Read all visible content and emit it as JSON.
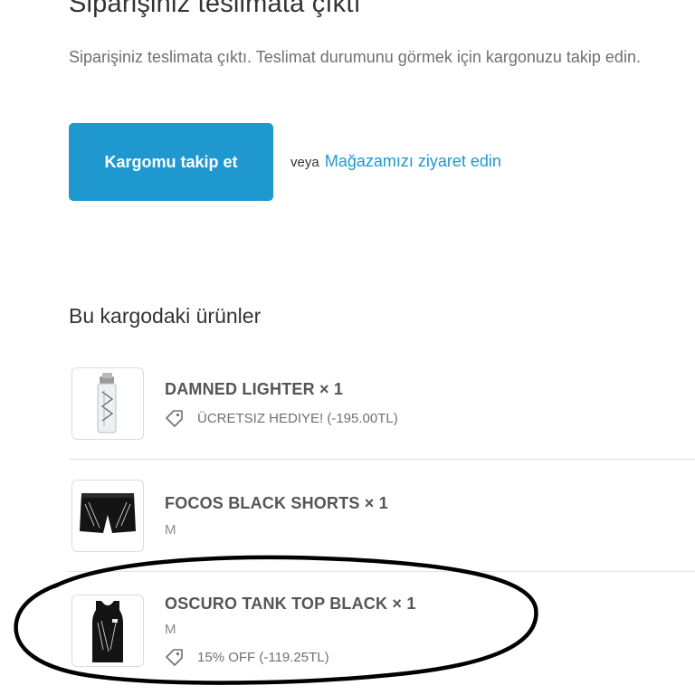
{
  "shipment": {
    "heading": "Siparişiniz teslimata çıktı",
    "message": "Siparişiniz teslimata çıktı. Teslimat durumunu görmek için kargonuzu takip edin.",
    "track_button": "Kargomu takip et",
    "or_text": "veya",
    "store_link": "Mağazamızı ziyaret edin"
  },
  "items_section": {
    "title": "Bu kargodaki ürünler",
    "items": [
      {
        "name": "DAMNED LIGHTER × 1",
        "discount": "ÜCRETSIZ HEDIYE! (-195.00TL)"
      },
      {
        "name": "FOCOS BLACK SHORTS × 1",
        "variant": "M"
      },
      {
        "name": "OSCURO TANK TOP BLACK × 1",
        "variant": "M",
        "discount": "15% OFF (-119.25TL)"
      }
    ]
  },
  "colors": {
    "accent": "#1f97cf",
    "text": "#333333",
    "muted": "#707070",
    "annotation": "#000000"
  },
  "icons": {
    "discount": "price-tag-icon"
  }
}
